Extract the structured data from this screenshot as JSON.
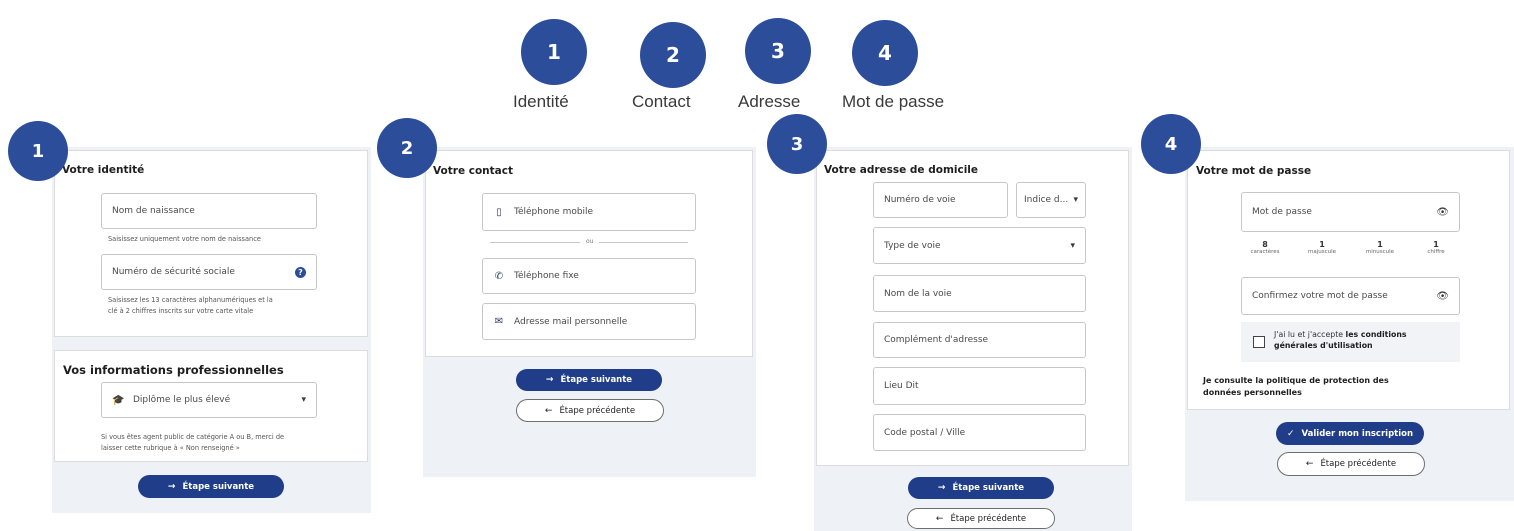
{
  "stepper": {
    "steps": [
      {
        "number": "1",
        "label": "Identité"
      },
      {
        "number": "2",
        "label": "Contact"
      },
      {
        "number": "3",
        "label": "Adresse"
      },
      {
        "number": "4",
        "label": "Mot de passe"
      }
    ]
  },
  "identity": {
    "badge": "1",
    "title": "Votre identité",
    "birth_name_placeholder": "Nom de naissance",
    "birth_name_hint": "Saisissez uniquement votre nom de naissance",
    "ssn_placeholder": "Numéro de sécurité sociale",
    "ssn_help_icon": "?",
    "ssn_hint_line1": "Saisissez les 13 caractères alphanumériques et la",
    "ssn_hint_line2": "clé à 2 chiffres inscrits sur votre carte vitale",
    "pro_title": "Vos informations professionnelles",
    "diploma_icon": "graduation-cap-icon",
    "diploma_placeholder": "Diplôme le plus élevé",
    "diploma_hint_line1": "Si vous êtes agent public de catégorie A ou B, merci de",
    "diploma_hint_line2": "laisser cette rubrique à « Non renseigné »",
    "next_label": "Étape suivante"
  },
  "contact": {
    "badge": "2",
    "title": "Votre contact",
    "mobile_placeholder": "Téléphone mobile",
    "or_label": "ou",
    "landline_placeholder": "Téléphone fixe",
    "email_placeholder": "Adresse mail personnelle",
    "next_label": "Étape suivante",
    "prev_label": "Étape précédente"
  },
  "address": {
    "badge": "3",
    "title": "Votre adresse de domicile",
    "street_number_placeholder": "Numéro de voie",
    "index_placeholder": "Indice d...",
    "street_type_placeholder": "Type de voie",
    "street_name_placeholder": "Nom de la voie",
    "complement_placeholder": "Complément d'adresse",
    "locality_placeholder": "Lieu Dit",
    "postal_city_placeholder": "Code postal / Ville",
    "next_label": "Étape suivante",
    "prev_label": "Étape précédente"
  },
  "password": {
    "badge": "4",
    "title": "Votre mot de passe",
    "password_placeholder": "Mot de passe",
    "requirements": [
      {
        "count": "8",
        "text": "caractères"
      },
      {
        "count": "1",
        "text": "majuscule"
      },
      {
        "count": "1",
        "text": "minuscule"
      },
      {
        "count": "1",
        "text": "chiffre"
      }
    ],
    "confirm_placeholder": "Confirmez votre mot de passe",
    "cgu_text_plain": "J'ai lu et j'accepte",
    "cgu_text_bold_1": "les conditions",
    "cgu_text_bold_2": "générales d'utilisation",
    "policy_line1": "Je consulte la politique de protection des",
    "policy_line2": "données personnelles",
    "submit_label": "Valider mon inscription",
    "prev_label": "Étape précédente"
  },
  "colors": {
    "primary": "#2b4d9a",
    "button": "#1f3d88",
    "panel_bg": "#eef1f6"
  }
}
